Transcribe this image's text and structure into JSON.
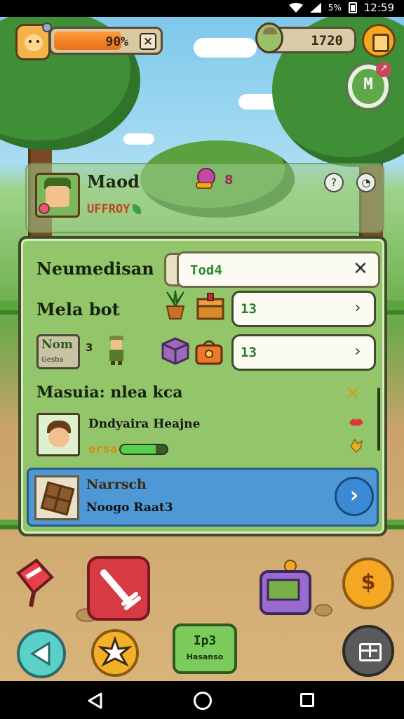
{
  "status_bar": {
    "battery_percent": "5%",
    "time": "12:59"
  },
  "hud": {
    "energy_percent_label": "90%",
    "energy_fill": 0.9,
    "energy_close": "×",
    "coins": "1720",
    "m_button_label": "M",
    "m_badge": "↗"
  },
  "profile": {
    "name": "Maod",
    "subtitle": "UFFROY",
    "gem_count": "8",
    "icon_left": "?",
    "icon_right": "◔"
  },
  "panel": {
    "row1_title": "Neumedisan",
    "search_value": "Tod4",
    "search_clear": "✕",
    "row2_title": "Mela bot",
    "row2_value": "13",
    "row3_tag_top": "Nom",
    "row3_tag_bottom": "Gesba",
    "row3_tag_num": "3",
    "row3_value": "13",
    "arrow": "›",
    "quest_title": "Masuia: nlea kca",
    "quest_x": "✕",
    "quest_name": "Dndyaira Heajne",
    "quest_label": "ersa",
    "quest_progress": 0.75,
    "feature_title": "Narrsch",
    "feature_subtitle": "Noogo Raat3",
    "feature_go": "›"
  },
  "actions": {
    "coin_symbol": "$",
    "center_top": "Ip3",
    "center_bottom": "Hasanso"
  },
  "colors": {
    "panel_bg": "#93c66a",
    "feature_bg": "#4e98d6",
    "energy": "#ff9a3c",
    "accent_red": "#d83a44"
  },
  "icons": [
    "wifi-icon",
    "signal-icon",
    "battery-icon",
    "gem-icon",
    "help-icon",
    "clock-icon",
    "plant-icon",
    "chest-icon",
    "cube-icon",
    "bag-icon",
    "axe-icon",
    "wrench-icon",
    "radio-icon",
    "coin-icon",
    "back-icon",
    "burst-icon",
    "grid-icon"
  ]
}
